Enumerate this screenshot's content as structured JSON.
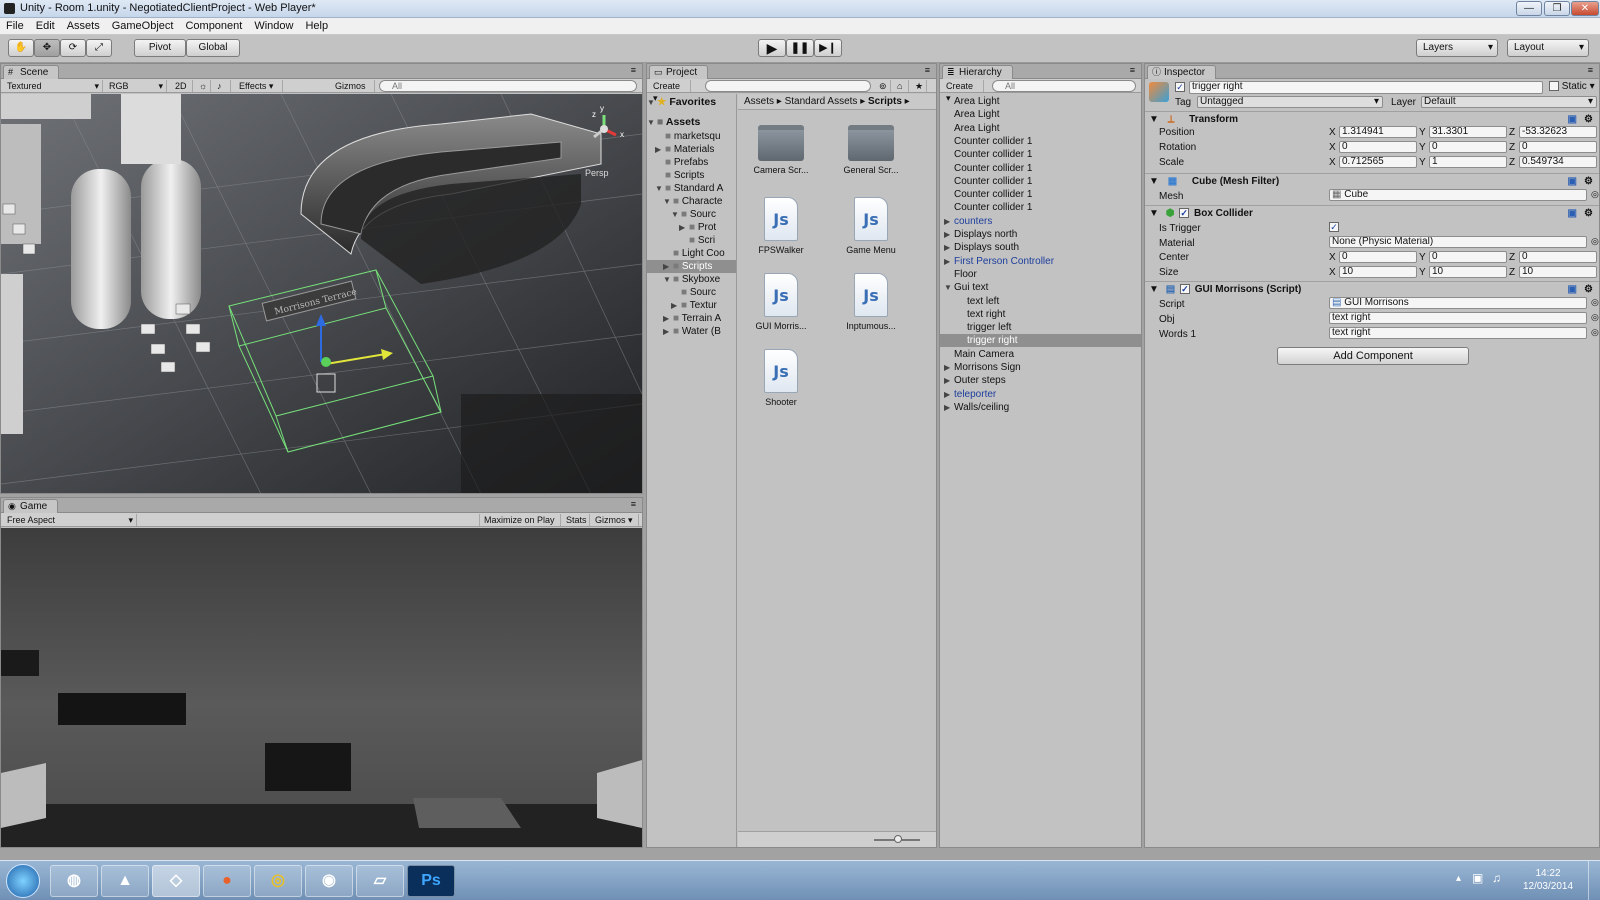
{
  "window": {
    "title": "Unity - Room 1.unity - NegotiatedClientProject - Web Player*",
    "min": "—",
    "max": "❐",
    "close": "✕"
  },
  "menu": [
    "File",
    "Edit",
    "Assets",
    "GameObject",
    "Component",
    "Window",
    "Help"
  ],
  "toolbar": {
    "pivot": "Pivot",
    "global": "Global",
    "layers": "Layers",
    "layout": "Layout"
  },
  "scene": {
    "tab": "Scene",
    "shading": "Textured",
    "rgb": "RGB",
    "mode2d": "2D",
    "effects": "Effects",
    "gizmos": "Gizmos",
    "search_placeholder": "All",
    "persp": "Persp",
    "sign_text": "Morrisons Terrace"
  },
  "game": {
    "tab": "Game",
    "aspect": "Free Aspect",
    "maximize": "Maximize on Play",
    "stats": "Stats",
    "gizmos": "Gizmos"
  },
  "project": {
    "tab": "Project",
    "create": "Create",
    "favorites": "Favorites",
    "assets_root": "Assets",
    "breadcrumb": [
      "Assets",
      "Standard Assets",
      "Scripts"
    ],
    "tree": [
      {
        "label": "marketsqu",
        "indent": 1,
        "arrow": ""
      },
      {
        "label": "Materials",
        "indent": 1,
        "arrow": "▶"
      },
      {
        "label": "Prefabs",
        "indent": 1,
        "arrow": ""
      },
      {
        "label": "Scripts",
        "indent": 1,
        "arrow": ""
      },
      {
        "label": "Standard A",
        "indent": 1,
        "arrow": "▼"
      },
      {
        "label": "Characte",
        "indent": 2,
        "arrow": "▼"
      },
      {
        "label": "Sourc",
        "indent": 3,
        "arrow": "▼"
      },
      {
        "label": "Prot",
        "indent": 4,
        "arrow": "▶"
      },
      {
        "label": "Scri",
        "indent": 4,
        "arrow": ""
      },
      {
        "label": "Light Coo",
        "indent": 2,
        "arrow": ""
      },
      {
        "label": "Scripts",
        "indent": 2,
        "arrow": "▶",
        "selected": true
      },
      {
        "label": "Skyboxe",
        "indent": 2,
        "arrow": "▼"
      },
      {
        "label": "Sourc",
        "indent": 3,
        "arrow": ""
      },
      {
        "label": "Textur",
        "indent": 3,
        "arrow": "▶"
      },
      {
        "label": "Terrain A",
        "indent": 2,
        "arrow": "▶"
      },
      {
        "label": "Water (B",
        "indent": 2,
        "arrow": "▶"
      }
    ],
    "assets": [
      {
        "label": "Camera Scr...",
        "kind": "folder"
      },
      {
        "label": "General Scr...",
        "kind": "folder"
      },
      {
        "label": "FPSWalker",
        "kind": "js"
      },
      {
        "label": "Game Menu",
        "kind": "js"
      },
      {
        "label": "GUI Morris...",
        "kind": "js"
      },
      {
        "label": "Inptumous...",
        "kind": "js"
      },
      {
        "label": "Shooter",
        "kind": "js"
      }
    ],
    "js_text": "Js"
  },
  "hierarchy": {
    "tab": "Hierarchy",
    "create": "Create",
    "search_placeholder": "All",
    "items": [
      {
        "label": "Area Light",
        "indent": 0,
        "arrow": ""
      },
      {
        "label": "Area Light",
        "indent": 0,
        "arrow": ""
      },
      {
        "label": "Area Light",
        "indent": 0,
        "arrow": ""
      },
      {
        "label": "Counter collider 1",
        "indent": 0,
        "arrow": ""
      },
      {
        "label": "Counter collider 1",
        "indent": 0,
        "arrow": ""
      },
      {
        "label": "Counter collider 1",
        "indent": 0,
        "arrow": ""
      },
      {
        "label": "Counter collider 1",
        "indent": 0,
        "arrow": ""
      },
      {
        "label": "Counter collider 1",
        "indent": 0,
        "arrow": ""
      },
      {
        "label": "Counter collider 1",
        "indent": 0,
        "arrow": ""
      },
      {
        "label": "counters",
        "indent": 0,
        "arrow": "▶",
        "blue": true
      },
      {
        "label": "Displays north",
        "indent": 0,
        "arrow": "▶"
      },
      {
        "label": "Displays south",
        "indent": 0,
        "arrow": "▶"
      },
      {
        "label": "First Person Controller",
        "indent": 0,
        "arrow": "▶",
        "blue": true
      },
      {
        "label": "Floor",
        "indent": 0,
        "arrow": ""
      },
      {
        "label": "Gui text",
        "indent": 0,
        "arrow": "▼"
      },
      {
        "label": "text left",
        "indent": 1,
        "arrow": ""
      },
      {
        "label": "text right",
        "indent": 1,
        "arrow": ""
      },
      {
        "label": "trigger left",
        "indent": 1,
        "arrow": ""
      },
      {
        "label": "trigger right",
        "indent": 1,
        "arrow": "",
        "selected": true
      },
      {
        "label": "Main Camera",
        "indent": 0,
        "arrow": ""
      },
      {
        "label": "Morrisons Sign",
        "indent": 0,
        "arrow": "▶"
      },
      {
        "label": "Outer steps",
        "indent": 0,
        "arrow": "▶"
      },
      {
        "label": "teleporter",
        "indent": 0,
        "arrow": "▶",
        "blue": true
      },
      {
        "label": "Walls/ceiling",
        "indent": 0,
        "arrow": "▶"
      }
    ]
  },
  "inspector": {
    "tab": "Inspector",
    "object_name": "trigger right",
    "static_label": "Static",
    "tag_label": "Tag",
    "tag_value": "Untagged",
    "layer_label": "Layer",
    "layer_value": "Default",
    "transform": {
      "title": "Transform",
      "position_label": "Position",
      "rotation_label": "Rotation",
      "scale_label": "Scale",
      "position": [
        "1.314941",
        "31.3301",
        "-53.32623"
      ],
      "rotation": [
        "0",
        "0",
        "0"
      ],
      "scale": [
        "0.712565",
        "1",
        "0.549734"
      ]
    },
    "axis": [
      "X",
      "Y",
      "Z"
    ],
    "mesh_filter": {
      "title": "Cube (Mesh Filter)",
      "mesh_label": "Mesh",
      "mesh_value": "Cube"
    },
    "box_collider": {
      "title": "Box Collider",
      "is_trigger_label": "Is Trigger",
      "material_label": "Material",
      "material_value": "None (Physic Material)",
      "center_label": "Center",
      "center": [
        "0",
        "0",
        "0"
      ],
      "size_label": "Size",
      "size": [
        "10",
        "10",
        "10"
      ]
    },
    "script": {
      "title": "GUI Morrisons (Script)",
      "script_label": "Script",
      "script_value": "GUI Morrisons",
      "obj_label": "Obj",
      "obj_value": "text right",
      "words_label": "Words 1",
      "words_value": "text right"
    },
    "add_component": "Add Component"
  },
  "taskbar": {
    "time": "14:22",
    "date": "12/03/2014",
    "apps": [
      "steam",
      "sketch",
      "unity",
      "maps",
      "chrome",
      "eye",
      "notes",
      "Ps"
    ],
    "ps_label": "Ps"
  }
}
